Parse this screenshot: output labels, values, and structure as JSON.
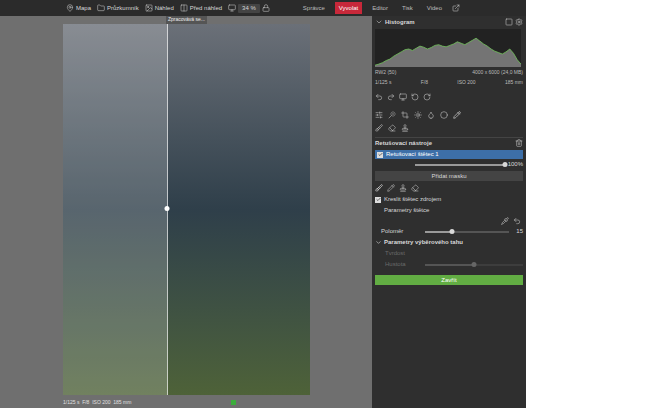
{
  "toolbar": {
    "items": [
      {
        "label": "Mapa"
      },
      {
        "label": "Průzkumník"
      },
      {
        "label": "Náhled"
      },
      {
        "label": "Před náhled"
      }
    ],
    "zoom": "34 %"
  },
  "modules": [
    {
      "label": "Správce",
      "selected": false
    },
    {
      "label": "Vyvolat",
      "selected": true
    },
    {
      "label": "Editor",
      "selected": false
    },
    {
      "label": "Tisk",
      "selected": false
    },
    {
      "label": "Video",
      "selected": false
    }
  ],
  "canvas": {
    "status": "Zpracovává se...",
    "split": 0.42
  },
  "histogram": {
    "title": "Histogram",
    "values": [
      0.05,
      0.08,
      0.12,
      0.18,
      0.22,
      0.3,
      0.36,
      0.42,
      0.48,
      0.5,
      0.46,
      0.52,
      0.58,
      0.55,
      0.5,
      0.54,
      0.6,
      0.62,
      0.58,
      0.56,
      0.6,
      0.64,
      0.7,
      0.66,
      0.62,
      0.68,
      0.74,
      0.8,
      0.72,
      0.64,
      0.58,
      0.5,
      0.44,
      0.4,
      0.36,
      0.42,
      0.5,
      0.38,
      0.2,
      0.08
    ]
  },
  "file_info": {
    "format": "RW2 (50)",
    "size": "4000 x 6000 (24,0 MB)"
  },
  "exposure": [
    "1/125 s",
    "F/8",
    "ISO 200",
    "185 mm"
  ],
  "retouch": {
    "title": "Retušovací nástroje",
    "layers": [
      {
        "label": "Retušovací štětec 1",
        "checked": true,
        "selected": true,
        "level": 1,
        "reading": "100%"
      }
    ],
    "add_mask": "Přidat masku",
    "draw_option": {
      "label": "Kreslit štětec zdrojem",
      "checked": true
    },
    "brush_section": "Parametry štětce",
    "radius": {
      "label": "Poloměr",
      "level": 0.32,
      "reading": "15"
    },
    "selection_section": {
      "label": "Parametry výběrového tahu",
      "expanded": true
    },
    "disabled_rows": [
      {
        "label": "Tvrdost",
        "kind": "label"
      },
      {
        "label": "Hustota",
        "kind": "slider",
        "level": 0.5
      }
    ]
  },
  "close_button": "Zavřít",
  "status_bar": {
    "text": "1/125 s  F/8  ISO 200  185 mm"
  }
}
